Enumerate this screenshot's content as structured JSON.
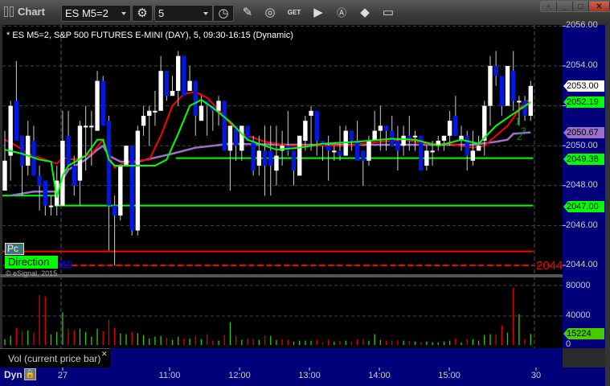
{
  "window": {
    "title": "Chart",
    "buttons": [
      "link-window",
      "minimize",
      "maximize",
      "close"
    ]
  },
  "toolbar": {
    "symbol": "ES M5=2",
    "interval": "5",
    "icons": [
      "settings-gear-icon",
      "clock-icon",
      "pencil-icon",
      "study-icon",
      "get-icon",
      "play-icon",
      "alert-icon",
      "cursor-icon",
      "comment-icon"
    ],
    "get_label": "GET"
  },
  "chart": {
    "title": "* ES M5=2, S&P 500 FUTURES E-MINI (DAY), 5, 09:30-16:15 (Dynamic)",
    "pc_label": "Pc",
    "direction_label": "Direction",
    "link_label": "om",
    "copyright": "© eSignal, 2015",
    "level_label_2044": "2044",
    "wave_labels": [
      "1",
      "2",
      "3"
    ],
    "price_axis": [
      "2056.00",
      "2054.00",
      "2052.00",
      "2050.00",
      "2048.00",
      "2046.00",
      "2044.00"
    ],
    "price_tags": [
      {
        "value": "2053.00",
        "color": "#ffffff"
      },
      {
        "value": "2052.19",
        "color": "#00ff00"
      },
      {
        "value": "2050.67",
        "color": "#9b72c8"
      },
      {
        "value": "2049.38",
        "color": "#00ff00"
      },
      {
        "value": "2047.00",
        "color": "#00ff00"
      }
    ]
  },
  "volume": {
    "legend": "Vol (current price bar)",
    "axis": [
      "80000",
      "40000",
      "0"
    ],
    "last_tag": "15224"
  },
  "footer": {
    "mode": "Dyn",
    "time_axis": [
      "27",
      "11:00",
      "12:00",
      "13:00",
      "14:00",
      "15:00",
      "30"
    ]
  },
  "colors": {
    "up_candle": "#ffffff",
    "down_candle": "#0018e0",
    "ma_fast": "#00ff00",
    "ma_slow": "#ff0000",
    "vwap": "#9b72c8",
    "axis_bg": "#00007a",
    "vol_up": "#33cc00",
    "vol_down": "#e00000"
  },
  "chart_data": {
    "type": "candlestick",
    "symbol": "ES M5=2",
    "ylim": [
      2043.9,
      2056.0
    ],
    "candles_ohlc": [
      [
        2047.75,
        2050.75,
        2047.75,
        2049.25
      ],
      [
        2049.5,
        2052.25,
        2048.25,
        2052
      ],
      [
        2052.25,
        2054.25,
        2050.25,
        2050.25
      ],
      [
        2050.5,
        2050.5,
        2047.5,
        2049
      ],
      [
        2049,
        2051.25,
        2048.5,
        2050.5
      ],
      [
        2050.25,
        2051,
        2048.5,
        2048.5
      ],
      [
        2048.5,
        2049,
        2046.75,
        2048
      ],
      [
        2048.25,
        2048.25,
        2046.5,
        2047
      ],
      [
        2047,
        2047.5,
        2046.5,
        2047
      ],
      [
        2047,
        2049,
        2046.5,
        2048.25
      ],
      [
        2047,
        2051.75,
        2047,
        2050.25
      ],
      [
        2050.5,
        2051.75,
        2049,
        2049
      ],
      [
        2049,
        2049.5,
        2047.5,
        2048
      ],
      [
        2048.25,
        2051.25,
        2047,
        2051
      ],
      [
        2051,
        2052,
        2048.75,
        2051
      ],
      [
        2051,
        2051.75,
        2049,
        2051
      ],
      [
        2050.75,
        2053.75,
        2050.75,
        2053.25
      ],
      [
        2053.25,
        2053.5,
        2051,
        2051
      ],
      [
        2051.25,
        2051.5,
        2044.75,
        2047
      ],
      [
        2047,
        2047.5,
        2044,
        2046.5
      ],
      [
        2046.5,
        2049,
        2046.25,
        2049
      ],
      [
        2049,
        2050,
        2049,
        2050
      ],
      [
        2050,
        2050,
        2045.5,
        2045.75
      ],
      [
        2045.75,
        2051,
        2045.5,
        2050.75
      ],
      [
        2051,
        2052,
        2050.5,
        2051.5
      ],
      [
        2051.5,
        2052,
        2050,
        2051.75
      ],
      [
        2051.75,
        2052.75,
        2051,
        2051.75
      ],
      [
        2051.75,
        2054.5,
        2051.75,
        2053.75
      ],
      [
        2053.75,
        2053.75,
        2052.25,
        2052.5
      ],
      [
        2052.5,
        2053.5,
        2052.5,
        2052.75
      ],
      [
        2052.75,
        2054.75,
        2052,
        2054.5
      ],
      [
        2054.5,
        2054.5,
        2052.5,
        2052.5
      ],
      [
        2052.75,
        2054,
        2052.75,
        2053.25
      ],
      [
        2053.25,
        2053.25,
        2050.5,
        2051.5
      ],
      [
        2051.25,
        2052.5,
        2051.25,
        2052
      ],
      [
        2052.25,
        2052.25,
        2050.5,
        2052
      ],
      [
        2052,
        2052,
        2050.75,
        2051.75
      ],
      [
        2051.75,
        2052.5,
        2051,
        2052.25
      ],
      [
        2052.25,
        2052.25,
        2049.75,
        2049.75
      ],
      [
        2049.75,
        2051,
        2047.75,
        2051
      ],
      [
        2051,
        2051,
        2049.25,
        2050
      ],
      [
        2049.75,
        2051,
        2049.25,
        2051
      ],
      [
        2051,
        2051,
        2050.25,
        2050.25
      ],
      [
        2050.25,
        2050.5,
        2048.5,
        2048.75
      ],
      [
        2049,
        2050.5,
        2048.5,
        2049.75
      ],
      [
        2049.75,
        2051,
        2047.5,
        2049
      ],
      [
        2049.75,
        2051,
        2047.5,
        2049
      ],
      [
        2048.75,
        2051,
        2048,
        2049.5
      ],
      [
        2049.75,
        2050.75,
        2049,
        2050
      ],
      [
        2050,
        2051.75,
        2049.5,
        2049.75
      ],
      [
        2049.75,
        2049.75,
        2048,
        2048.75
      ],
      [
        2048.5,
        2050.5,
        2048.5,
        2050.5
      ],
      [
        2050.25,
        2051.5,
        2049.75,
        2051.25
      ],
      [
        2051.5,
        2052,
        2049.75,
        2051.75
      ],
      [
        2051.75,
        2051.75,
        2049.5,
        2050.25
      ],
      [
        2050.25,
        2050.25,
        2049.25,
        2050
      ],
      [
        2050,
        2050.5,
        2048.25,
        2049.75
      ],
      [
        2049.75,
        2050,
        2049.25,
        2049.75
      ],
      [
        2049.75,
        2051,
        2049.25,
        2049.5
      ],
      [
        2049.5,
        2051,
        2049.5,
        2050.75
      ],
      [
        2050.75,
        2050.75,
        2049.75,
        2050.25
      ],
      [
        2050.25,
        2051.25,
        2049.25,
        2049.25
      ],
      [
        2049.75,
        2049.75,
        2048,
        2049.25
      ],
      [
        2049.25,
        2050.5,
        2049,
        2050.25
      ],
      [
        2050.25,
        2051.75,
        2050.25,
        2050.75
      ],
      [
        2050.75,
        2052,
        2049.75,
        2051
      ],
      [
        2051,
        2051,
        2049.75,
        2050.75
      ],
      [
        2050.75,
        2051.5,
        2050,
        2050
      ],
      [
        2050.25,
        2051,
        2048.75,
        2049.75
      ],
      [
        2050,
        2051,
        2049.5,
        2050.5
      ],
      [
        2050.5,
        2051.5,
        2049.75,
        2050.25
      ],
      [
        2050.5,
        2050.75,
        2049.75,
        2050.5
      ],
      [
        2050.5,
        2050.5,
        2048.75,
        2048.75
      ],
      [
        2049,
        2050,
        2048.75,
        2049.75
      ],
      [
        2049.75,
        2050.25,
        2049,
        2049.75
      ],
      [
        2050,
        2050.5,
        2049.75,
        2050.25
      ],
      [
        2050.25,
        2050.5,
        2049.75,
        2050.5
      ],
      [
        2050.5,
        2051.75,
        2050,
        2051.25
      ],
      [
        2051.5,
        2052.5,
        2050.5,
        2050.5
      ],
      [
        2050.25,
        2051,
        2049.75,
        2050.5
      ],
      [
        2050.5,
        2050.75,
        2048.75,
        2049.5
      ],
      [
        2049.25,
        2050.75,
        2049,
        2049.75
      ],
      [
        2049.75,
        2050.5,
        2049.75,
        2050
      ],
      [
        2050.25,
        2052.25,
        2049.5,
        2052
      ],
      [
        2052,
        2054.5,
        2051,
        2054
      ],
      [
        2054,
        2054.75,
        2053,
        2053.5
      ],
      [
        2053.5,
        2053.5,
        2051.5,
        2052
      ],
      [
        2052,
        2054,
        2052,
        2054
      ],
      [
        2053.75,
        2054.75,
        2051.75,
        2052.25
      ],
      [
        2052.25,
        2052.5,
        2051,
        2052.25
      ],
      [
        2052.25,
        2052.5,
        2051.25,
        2051.5
      ],
      [
        2051.5,
        2053.25,
        2051.25,
        2053
      ]
    ],
    "ma_fast": [
      [
        1,
        49.8
      ],
      [
        4,
        49.6
      ],
      [
        7,
        49.3
      ],
      [
        9,
        49.2
      ],
      [
        10,
        47.4
      ],
      [
        11,
        48.5
      ],
      [
        12,
        49.0
      ],
      [
        15,
        49.5
      ],
      [
        17,
        50.3
      ],
      [
        18,
        50.3
      ],
      [
        19,
        49.3
      ],
      [
        20,
        49.0
      ],
      [
        27,
        49.0
      ],
      [
        29,
        49.3
      ],
      [
        31,
        50.6
      ],
      [
        33,
        52.0
      ],
      [
        35,
        52.3
      ],
      [
        37,
        51.9
      ],
      [
        40,
        51.2
      ],
      [
        43,
        50.3
      ],
      [
        46,
        50.0
      ],
      [
        48,
        49.8
      ],
      [
        52,
        49.9
      ],
      [
        56,
        50.1
      ],
      [
        62,
        50.2
      ],
      [
        68,
        50.35
      ],
      [
        72,
        50.3
      ],
      [
        76,
        50.0
      ],
      [
        80,
        50.3
      ],
      [
        83,
        50.1
      ],
      [
        86,
        51.0
      ],
      [
        89,
        51.6
      ],
      [
        92,
        52.19
      ]
    ],
    "ma_slow": [
      [
        1,
        50.3
      ],
      [
        3,
        50.0
      ],
      [
        5,
        49.6
      ],
      [
        8,
        49.3
      ],
      [
        10,
        49.1
      ],
      [
        11,
        49.4
      ],
      [
        13,
        49.3
      ],
      [
        16,
        49.6
      ],
      [
        18,
        50.3
      ],
      [
        19,
        49.5
      ],
      [
        20,
        48.9
      ],
      [
        22,
        49.2
      ],
      [
        26,
        49.3
      ],
      [
        28,
        50.5
      ],
      [
        30,
        52.0
      ],
      [
        32,
        52.6
      ],
      [
        34,
        52.7
      ],
      [
        36,
        52.4
      ],
      [
        38,
        51.8
      ],
      [
        40,
        51.1
      ],
      [
        42,
        50.6
      ],
      [
        46,
        50.2
      ],
      [
        50,
        50.0
      ],
      [
        60,
        50.0
      ],
      [
        66,
        50.2
      ],
      [
        70,
        50.3
      ],
      [
        74,
        50.1
      ],
      [
        78,
        50.1
      ],
      [
        82,
        49.9
      ],
      [
        84,
        50.0
      ],
      [
        88,
        51.0
      ],
      [
        91,
        52.2
      ],
      [
        92,
        52.3
      ]
    ],
    "vwap": [
      [
        2,
        47.5
      ],
      [
        6,
        47.7
      ],
      [
        10,
        47.7
      ],
      [
        11,
        48.3
      ],
      [
        12,
        48.8
      ],
      [
        15,
        49.3
      ],
      [
        17,
        49.8
      ],
      [
        18,
        50.0
      ],
      [
        19,
        49.5
      ],
      [
        21,
        49.2
      ],
      [
        24,
        49.2
      ],
      [
        27,
        49.4
      ],
      [
        30,
        49.6
      ],
      [
        34,
        49.9
      ],
      [
        40,
        50.1
      ],
      [
        50,
        50.05
      ],
      [
        70,
        50.05
      ],
      [
        82,
        50.05
      ],
      [
        86,
        50.2
      ],
      [
        88,
        50.3
      ],
      [
        89,
        50.6
      ],
      [
        92,
        50.67
      ]
    ],
    "price_base": 2000,
    "levels": [
      {
        "price": 2047.5,
        "from_bar": 1,
        "to_bar": 10,
        "color": "#00ff00",
        "style": "solid"
      },
      {
        "price": 2049.38,
        "from_bar": 31,
        "to_bar": 92,
        "color": "#00ff00",
        "style": "solid"
      },
      {
        "price": 2047.0,
        "from_bar": 10,
        "to_bar": 92,
        "color": "#00ff00",
        "style": "solid"
      },
      {
        "price": 2044.7,
        "from_bar": 1,
        "to_bar": 92,
        "color": "#ff0000",
        "style": "solid"
      },
      {
        "price": 2044.0,
        "from_bar": 13,
        "to_bar": 92,
        "color": "#ff0000",
        "style": "dashed"
      }
    ],
    "volume": [
      [
        8000,
        "g"
      ],
      [
        12600,
        "g"
      ],
      [
        23700,
        "r"
      ],
      [
        19600,
        "r"
      ],
      [
        20000,
        "g"
      ],
      [
        17000,
        "r"
      ],
      [
        69000,
        "r"
      ],
      [
        67000,
        "r"
      ],
      [
        14800,
        "g"
      ],
      [
        18000,
        "g"
      ],
      [
        45000,
        "g"
      ],
      [
        22600,
        "r"
      ],
      [
        20000,
        "r"
      ],
      [
        22600,
        "g"
      ],
      [
        18000,
        "g"
      ],
      [
        11500,
        "g"
      ],
      [
        22600,
        "g"
      ],
      [
        19000,
        "r"
      ],
      [
        35000,
        "r"
      ],
      [
        23700,
        "r"
      ],
      [
        16000,
        "g"
      ],
      [
        15000,
        "g"
      ],
      [
        18000,
        "r"
      ],
      [
        16000,
        "g"
      ],
      [
        13700,
        "g"
      ],
      [
        9000,
        "g"
      ],
      [
        11500,
        "g"
      ],
      [
        12600,
        "g"
      ],
      [
        10000,
        "r"
      ],
      [
        7000,
        "g"
      ],
      [
        11500,
        "g"
      ],
      [
        9000,
        "r"
      ],
      [
        9000,
        "g"
      ],
      [
        12600,
        "r"
      ],
      [
        8000,
        "g"
      ],
      [
        15000,
        "r"
      ],
      [
        6000,
        "r"
      ],
      [
        6000,
        "g"
      ],
      [
        13700,
        "r"
      ],
      [
        31500,
        "g"
      ],
      [
        12600,
        "r"
      ],
      [
        7000,
        "g"
      ],
      [
        9000,
        "r"
      ],
      [
        8000,
        "r"
      ],
      [
        7000,
        "g"
      ],
      [
        12600,
        "r"
      ],
      [
        12600,
        "g"
      ],
      [
        7000,
        "g"
      ],
      [
        8000,
        "r"
      ],
      [
        7000,
        "r"
      ],
      [
        4800,
        "g"
      ],
      [
        6000,
        "g"
      ],
      [
        6000,
        "g"
      ],
      [
        6000,
        "g"
      ],
      [
        7000,
        "r"
      ],
      [
        3700,
        "r"
      ],
      [
        7000,
        "r"
      ],
      [
        4800,
        "g"
      ],
      [
        6000,
        "r"
      ],
      [
        6000,
        "g"
      ],
      [
        4800,
        "r"
      ],
      [
        8000,
        "r"
      ],
      [
        8000,
        "r"
      ],
      [
        6000,
        "g"
      ],
      [
        15000,
        "g"
      ],
      [
        7000,
        "g"
      ],
      [
        6000,
        "r"
      ],
      [
        6000,
        "r"
      ],
      [
        7000,
        "r"
      ],
      [
        6000,
        "g"
      ],
      [
        6000,
        "r"
      ],
      [
        4800,
        "g"
      ],
      [
        3700,
        "r"
      ],
      [
        4800,
        "g"
      ],
      [
        3700,
        "g"
      ],
      [
        3700,
        "g"
      ],
      [
        4800,
        "g"
      ],
      [
        6000,
        "g"
      ],
      [
        9000,
        "r"
      ],
      [
        3700,
        "g"
      ],
      [
        8000,
        "r"
      ],
      [
        8000,
        "g"
      ],
      [
        6000,
        "g"
      ],
      [
        13700,
        "g"
      ],
      [
        15000,
        "g"
      ],
      [
        15000,
        "r"
      ],
      [
        27000,
        "r"
      ],
      [
        17000,
        "g"
      ],
      [
        79000,
        "r"
      ],
      [
        42600,
        "g"
      ],
      [
        8000,
        "r"
      ],
      [
        15224,
        "g"
      ]
    ]
  }
}
